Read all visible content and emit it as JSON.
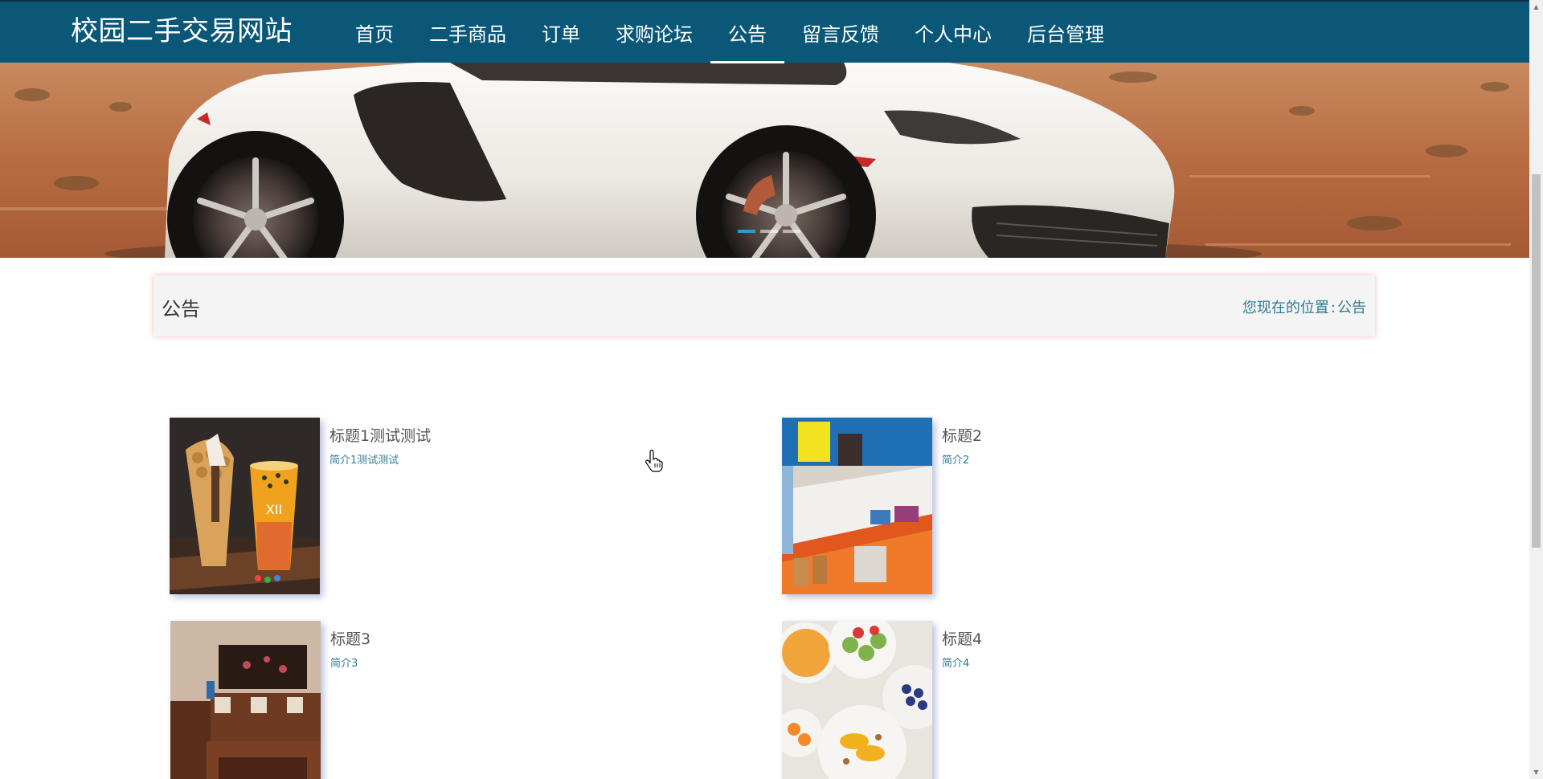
{
  "header": {
    "site_title": "校园二手交易网站",
    "nav_items": [
      {
        "label": "首页"
      },
      {
        "label": "二手商品"
      },
      {
        "label": "订单"
      },
      {
        "label": "求购论坛"
      },
      {
        "label": "公告",
        "active": true
      },
      {
        "label": "留言反馈"
      },
      {
        "label": "个人中心"
      },
      {
        "label": "后台管理"
      }
    ],
    "bar_color": "#0a5778"
  },
  "banner": {
    "image": "white-sports-car-desert",
    "slides": 3,
    "active_slide": 1
  },
  "breadcrumb": {
    "title": "公告",
    "location_label": "您现在的位置",
    "separator": ":",
    "current": "公告"
  },
  "notices": [
    {
      "title": "标题1测试测试",
      "summary": "简介1测试测试",
      "image": "bubble-waffle-and-drink"
    },
    {
      "title": "标题2",
      "summary": "简介2",
      "image": "colorful-shop-shelves"
    },
    {
      "title": "标题3",
      "summary": "简介3",
      "image": "wooden-furniture-room"
    },
    {
      "title": "标题4",
      "summary": "简介4",
      "image": "fruit-yogurt-bowls"
    }
  ],
  "colors": {
    "accent_text": "#2d7c93",
    "active_dot": "#2a9bd3"
  }
}
